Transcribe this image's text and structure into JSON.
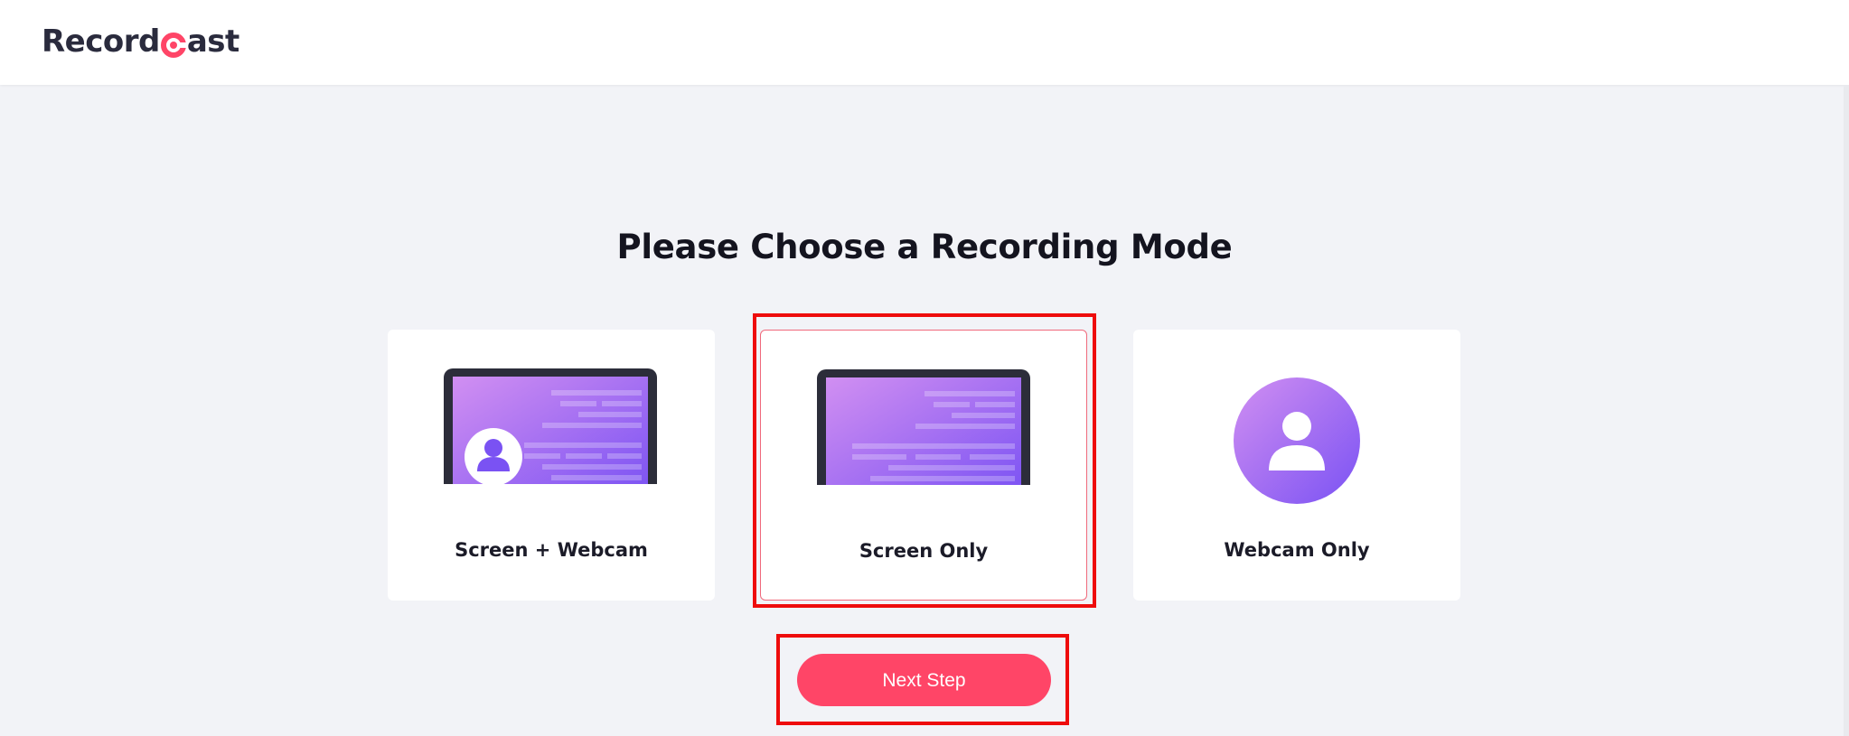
{
  "header": {
    "logo_part1": "Record",
    "logo_part2": "ast",
    "logo_mark_icon": "record-c-icon"
  },
  "main": {
    "title": "Please Choose a Recording Mode",
    "modes": [
      {
        "label": "Screen + Webcam",
        "icon": "laptop-with-webcam-icon",
        "selected": false
      },
      {
        "label": "Screen Only",
        "icon": "laptop-screen-icon",
        "selected": true
      },
      {
        "label": "Webcam Only",
        "icon": "user-avatar-icon",
        "selected": false
      }
    ],
    "next_label": "Next Step"
  },
  "colors": {
    "brand": "#ff4567",
    "logo_text": "#2a2b3d",
    "screen_gradient_start": "#d18ff2",
    "screen_gradient_end": "#7a52f3",
    "highlight": "#ee0c0c",
    "background": "#f2f3f7"
  }
}
